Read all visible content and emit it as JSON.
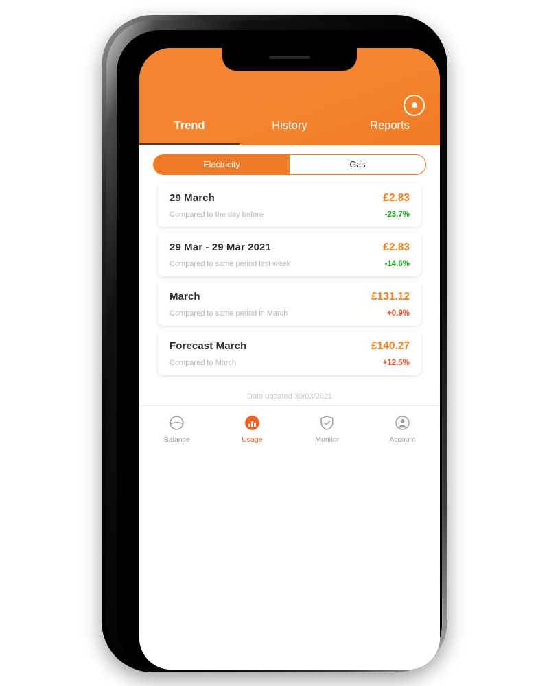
{
  "device": {
    "notch": "iphone-notch",
    "speaker_icon": "speaker-grille"
  },
  "header": {
    "bell_icon": "bell-icon",
    "tabs": [
      {
        "label": "Trend",
        "active": true
      },
      {
        "label": "History",
        "active": false
      },
      {
        "label": "Reports",
        "active": false
      }
    ]
  },
  "fuel_toggle": {
    "options": [
      {
        "label": "Electricity",
        "selected": true
      },
      {
        "label": "Gas",
        "selected": false
      }
    ]
  },
  "cards": [
    {
      "title": "29 March",
      "amount": "£2.83",
      "subtitle": "Compared to the day before",
      "delta": "-23.7%",
      "direction": "down"
    },
    {
      "title": "29 Mar - 29 Mar 2021",
      "amount": "£2.83",
      "subtitle": "Compared to same period last week",
      "delta": "-14.6%",
      "direction": "down"
    },
    {
      "title": "March",
      "amount": "£131.12",
      "subtitle": "Compared to same period in March",
      "delta": "+0.9%",
      "direction": "up"
    },
    {
      "title": "Forecast March",
      "amount": "£140.27",
      "subtitle": "Compared to March",
      "delta": "+12.5%",
      "direction": "up"
    }
  ],
  "footer": {
    "date_updated": "Date updated 30/03/2021"
  },
  "bottom_nav": [
    {
      "label": "Balance",
      "icon": "balance-circle-icon",
      "active": false
    },
    {
      "label": "Usage",
      "icon": "usage-bars-icon",
      "active": true
    },
    {
      "label": "Monitor",
      "icon": "shield-check-icon",
      "active": false
    },
    {
      "label": "Account",
      "icon": "person-circle-icon",
      "active": false
    }
  ],
  "colors": {
    "brand_orange": "#f4821f",
    "header_orange": "#f58435",
    "delta_down_green": "#16a516",
    "delta_up_red": "#f04a20",
    "active_tab_underline": "#3c4044",
    "muted_text": "#b3b6ba"
  }
}
